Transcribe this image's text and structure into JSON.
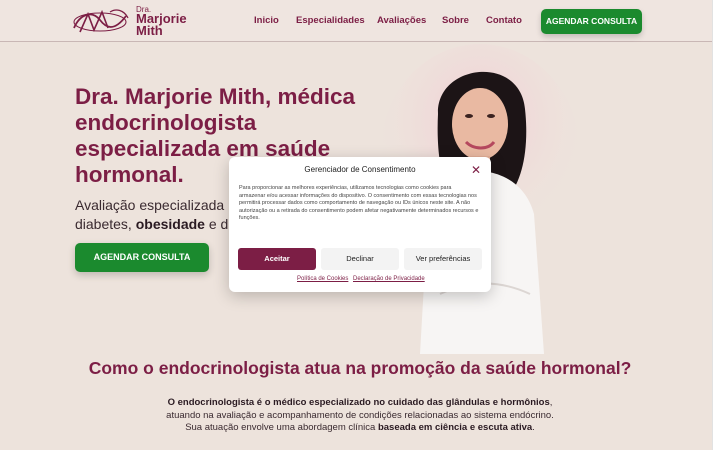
{
  "header": {
    "logo": {
      "prefix": "Dra.",
      "name": "Marjorie Mith"
    },
    "nav": [
      "Inicio",
      "Especialidades",
      "Avaliações",
      "Sobre",
      "Contato"
    ],
    "cta": "AGENDAR CONSULTA"
  },
  "hero": {
    "title": "Dra. Marjorie Mith, médica endocrinologista especializada em saúde hormonal.",
    "subtitle_prefix": "Avaliação especializada p",
    "subtitle_line2_a": "diabetes, ",
    "subtitle_bold": "obesidade",
    "subtitle_line2_b": " e dis",
    "cta": "AGENDAR CONSULTA"
  },
  "consent": {
    "title": "Gerenciador de Consentimento",
    "text": "Para proporcionar as melhores experiências, utilizamos tecnologias como cookies para armazenar e/ou acessar informações do dispositivo. O consentimento com essas tecnologias nos permitirá processar dados como comportamento de navegação ou IDs únicos neste site. A não autorização ou a retirada do consentimento podem afetar negativamente determinados recursos e funções.",
    "accept": "Aceitar",
    "decline": "Declinar",
    "preferences": "Ver preferências",
    "cookie_policy": "Política de Cookies",
    "privacy": "Declaração de Privacidade"
  },
  "section": {
    "title": "Como o endocrinologista atua na promoção da saúde hormonal?",
    "line1_bold": "O endocrinologista é o médico especializado no cuidado das glândulas e hormônios",
    "line1_end": ",",
    "line2": "atuando na avaliação e acompanhamento de condições relacionadas ao sistema endócrino.",
    "line3_a": "Sua atuação envolve uma abordagem clínica ",
    "line3_bold": "baseada em ciência e escuta ativa",
    "line3_end": "."
  },
  "colors": {
    "brand": "#7c1e45",
    "cta": "#1b8a2e",
    "background": "#ede3dc"
  }
}
